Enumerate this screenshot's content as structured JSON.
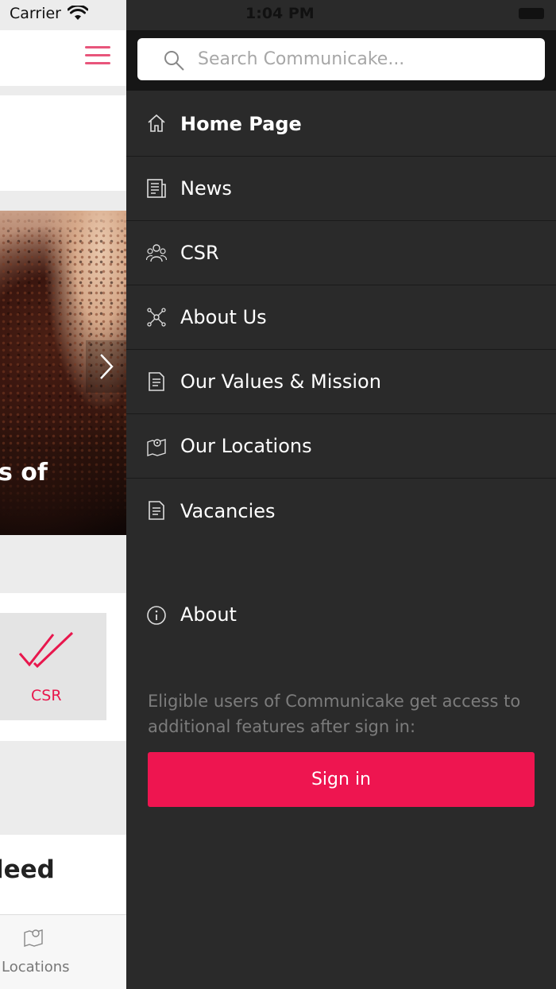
{
  "status_bar": {
    "carrier": "Carrier",
    "time": "1:04 PM"
  },
  "colors": {
    "accent": "#ee1550",
    "drawer_bg": "#2a2a2a",
    "hamburger": "#e8557b"
  },
  "background_app": {
    "hero_caption": "s of",
    "csr_tile_label": "CSR",
    "partial_heading": "leed",
    "tab_label": "Locations"
  },
  "drawer": {
    "search": {
      "placeholder": "Search Communicake..."
    },
    "menu": [
      {
        "label": "Home Page",
        "icon": "home-icon",
        "active": true
      },
      {
        "label": "News",
        "icon": "news-icon"
      },
      {
        "label": "CSR",
        "icon": "people-icon"
      },
      {
        "label": "About Us",
        "icon": "network-icon"
      },
      {
        "label": "Our Values & Mission",
        "icon": "document-icon"
      },
      {
        "label": "Our Locations",
        "icon": "map-pin-icon"
      },
      {
        "label": "Vacancies",
        "icon": "document-icon"
      }
    ],
    "about": {
      "label": "About",
      "icon": "info-icon"
    },
    "sign_in_note": "Eligible users of Communicake get access to additional features after sign in:",
    "sign_in_button": "Sign in"
  }
}
